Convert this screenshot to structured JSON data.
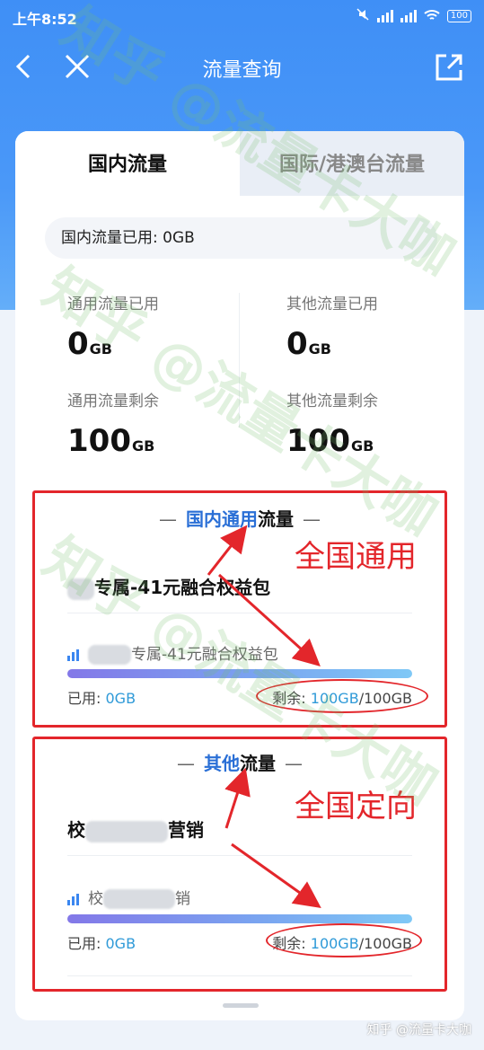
{
  "status_bar": {
    "time": "上午8:52",
    "battery": "100"
  },
  "nav": {
    "title": "流量查询"
  },
  "tabs": {
    "domestic": "国内流量",
    "international": "国际/港澳台流量"
  },
  "summary": {
    "used_label": "国内流量已用: 0GB",
    "general_used_label": "通用流量已用",
    "general_used_value": "0",
    "general_used_unit": "GB",
    "other_used_label": "其他流量已用",
    "other_used_value": "0",
    "other_used_unit": "GB",
    "general_remaining_label": "通用流量剩余",
    "general_remaining_value": "100",
    "general_remaining_unit": "GB",
    "other_remaining_label": "其他流量剩余",
    "other_remaining_value": "100",
    "other_remaining_unit": "GB"
  },
  "general_section": {
    "title_highlight": "国内通用",
    "title_rest": "流量",
    "package_name": "专属-41元融合权益包",
    "sub_package_name": "专属-41元融合权益包",
    "used_label": "已用: ",
    "used_value": "0GB",
    "remaining_label": "剩余: ",
    "remaining_value": "100GB",
    "remaining_total": "/100GB",
    "remaining_fraction": 1.0
  },
  "other_section": {
    "title_highlight": "其他",
    "title_rest": "流量",
    "package_name_start": "校",
    "package_name_end": "营销",
    "sub_package_name_start": "校",
    "sub_package_name_end": "销",
    "used_label": "已用: ",
    "used_value": "0GB",
    "remaining_label": "剩余: ",
    "remaining_value": "100GB",
    "remaining_total": "/100GB",
    "remaining_fraction": 1.0
  },
  "annotations": {
    "general_label": "全国通用",
    "other_label": "全国定向"
  },
  "watermark": {
    "text": "知乎 @流量卡大咖",
    "footer": "知乎 @流量卡大咖"
  },
  "colors": {
    "accent": "#2a6fd6",
    "annotation": "#e3262b",
    "value": "#2f9ad8"
  }
}
